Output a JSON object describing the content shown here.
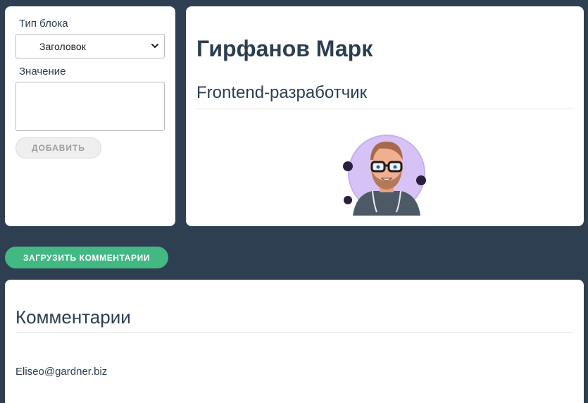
{
  "form": {
    "block_type_label": "Тип блока",
    "block_type_value": "Заголовок",
    "value_label": "Значение",
    "value_text": "",
    "add_button": "ДОБАВИТЬ"
  },
  "profile": {
    "name": "Гирфанов Марк",
    "role": "Frontend-разработчик"
  },
  "load_comments_button": "ЗАГРУЗИТЬ КОММЕНТАРИИ",
  "comments": {
    "title": "Комментарии",
    "items": [
      {
        "email": "Eliseo@gardner.biz"
      }
    ]
  },
  "colors": {
    "background": "#2e3f52",
    "card": "#ffffff",
    "accent": "#42b883",
    "text": "#2c3e50"
  },
  "icons": [
    "chevron-down-icon",
    "avatar-illustration"
  ]
}
